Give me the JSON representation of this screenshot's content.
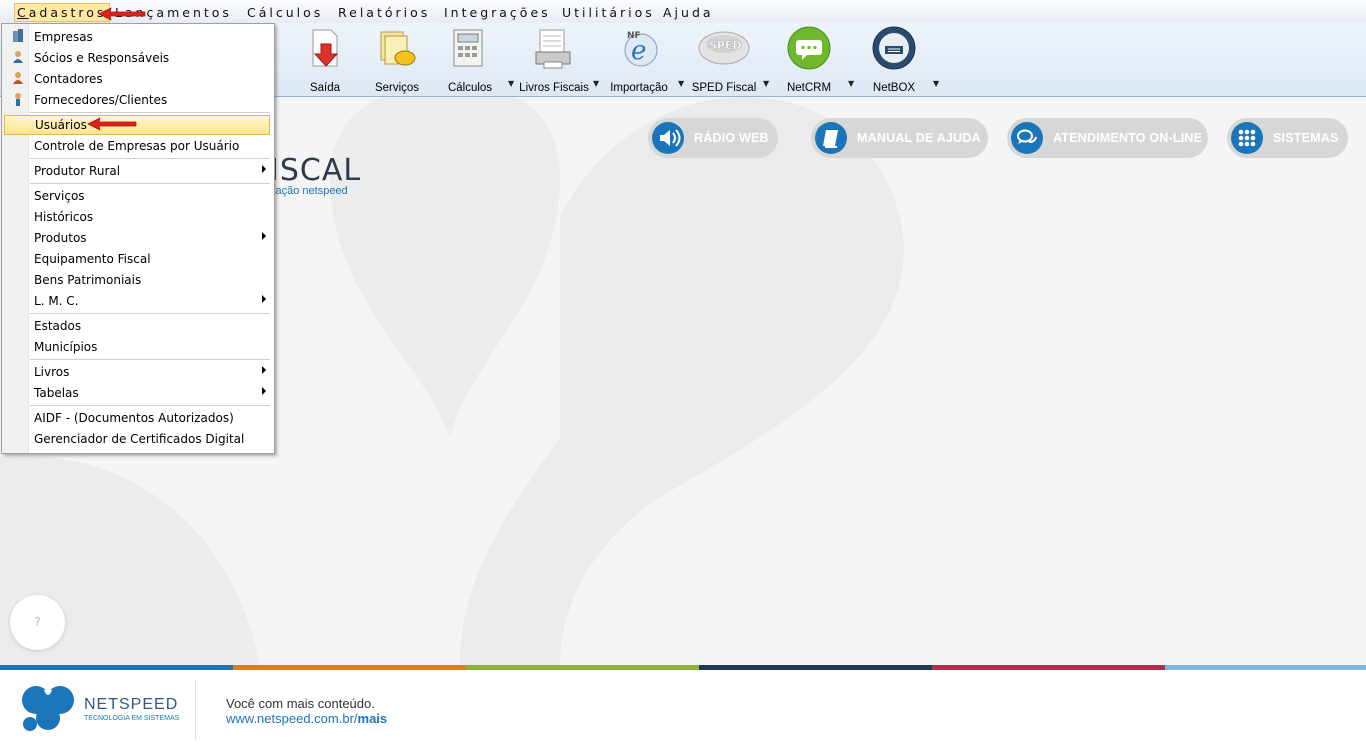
{
  "menubar": {
    "items": [
      {
        "label": "Cadastros",
        "key": "C"
      },
      {
        "label": "Lançamentos",
        "key": "L"
      },
      {
        "label": "Cálculos",
        "key": "C"
      },
      {
        "label": "Relatórios",
        "key": "R"
      },
      {
        "label": "Integrações",
        "key": "I"
      },
      {
        "label": "Utilitários",
        "key": "U"
      },
      {
        "label": "Ajuda",
        "key": "u"
      }
    ]
  },
  "toolbar": {
    "buttons": [
      {
        "label": "Saída",
        "icon": "exit-doc-icon"
      },
      {
        "label": "Serviços",
        "icon": "services-icon"
      },
      {
        "label": "Cálculos",
        "icon": "calculator-icon"
      },
      {
        "label": "Livros Fiscais",
        "icon": "fiscal-books-icon"
      },
      {
        "label": "Importação",
        "icon": "nfe-import-icon"
      },
      {
        "label": "SPED Fiscal",
        "icon": "sped-icon"
      },
      {
        "label": "NetCRM",
        "icon": "chat-bubble-icon"
      },
      {
        "label": "NetBOX",
        "icon": "netbox-icon"
      }
    ]
  },
  "quick_links": [
    {
      "label": "RÁDIO WEB",
      "icon": "speaker-icon"
    },
    {
      "label": "MANUAL DE AJUDA",
      "icon": "book-icon"
    },
    {
      "label": "ATENDIMENTO ON-LINE",
      "icon": "chat-icon"
    },
    {
      "label": "SISTEMAS",
      "icon": "grid-icon"
    }
  ],
  "logo": {
    "big": "ISCAL",
    "small": "vação netspeed"
  },
  "help_button": "?",
  "dropdown": {
    "items": [
      {
        "label": "Empresas"
      },
      {
        "label": "Sócios e Responsáveis"
      },
      {
        "label": "Contadores"
      },
      {
        "label": "Fornecedores/Clientes"
      },
      {
        "label": "Usuários"
      },
      {
        "label": "Controle de Empresas por Usuário"
      },
      {
        "label": "Produtor Rural"
      },
      {
        "label": "Serviços"
      },
      {
        "label": "Históricos"
      },
      {
        "label": "Produtos"
      },
      {
        "label": "Equipamento Fiscal"
      },
      {
        "label": "Bens Patrimoniais"
      },
      {
        "label": "L. M. C."
      },
      {
        "label": "Estados"
      },
      {
        "label": "Municípios"
      },
      {
        "label": "Livros"
      },
      {
        "label": "Tabelas"
      },
      {
        "label": "AIDF - (Documentos Autorizados)"
      },
      {
        "label": "Gerenciador de Certificados Digital"
      }
    ]
  },
  "footer": {
    "brand": "NETSPEED",
    "tagline": "TECNOLOGIA EM SISTEMAS",
    "message": "Você com mais conteúdo.",
    "url_prefix": "www.netspeed.com.br/",
    "url_suffix": "mais"
  },
  "colors": {
    "accent_blue": "#1b76b9",
    "stripe_1": "#1a74b8",
    "stripe_2": "#d97f1e",
    "stripe_3": "#8db33a",
    "stripe_4": "#1d3a57",
    "stripe_5": "#b0304a",
    "stripe_6": "#7fb9df",
    "arrow_red": "#e0201a"
  }
}
